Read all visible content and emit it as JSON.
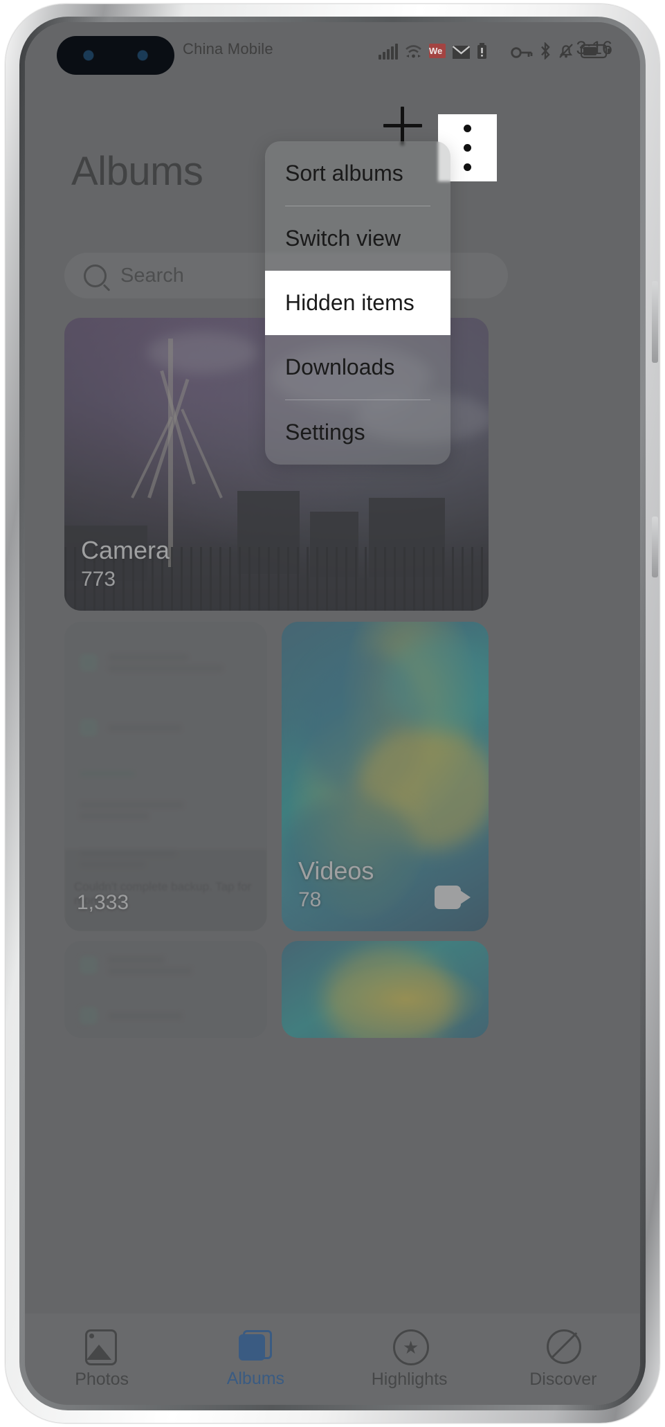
{
  "status_bar": {
    "carrier": "China Mobile",
    "clock": "3:16",
    "icons": [
      "signal-bars-icon",
      "wifi-icon",
      "wechat-icon",
      "mail-icon",
      "sim-alert-icon",
      "vpn-key-icon",
      "bluetooth-icon",
      "mute-bell-icon",
      "battery-icon"
    ],
    "wechat_badge": "We"
  },
  "appbar": {
    "add_label": "+",
    "more_label": "⋮"
  },
  "page": {
    "title": "Albums"
  },
  "search": {
    "placeholder": "Search",
    "icon": "search-icon"
  },
  "menu": {
    "items": [
      {
        "label": "Sort albums",
        "highlighted": false,
        "separator_after": true
      },
      {
        "label": "Switch view",
        "highlighted": false,
        "separator_after": false
      },
      {
        "label": "Hidden items",
        "highlighted": true,
        "separator_after": false
      },
      {
        "label": "Downloads",
        "highlighted": false,
        "separator_after": true
      },
      {
        "label": "Settings",
        "highlighted": false,
        "separator_after": false
      }
    ]
  },
  "albums": [
    {
      "title": "Camera",
      "count": "773"
    },
    {
      "title": "Videos",
      "count": "78"
    },
    {
      "title": "",
      "count": "1,333"
    }
  ],
  "blurred_card": {
    "banner_text": "Couldn't complete backup. Tap for more info.",
    "row_labels": [
      "Theme",
      "System default",
      "Wallpaper"
    ]
  },
  "bottom_nav": {
    "items": [
      {
        "label": "Photos",
        "icon": "photo-icon",
        "active": false
      },
      {
        "label": "Albums",
        "icon": "albums-icon",
        "active": true
      },
      {
        "label": "Highlights",
        "icon": "star-circle-icon",
        "active": false
      },
      {
        "label": "Discover",
        "icon": "discover-icon",
        "active": false
      }
    ]
  },
  "colors": {
    "accent": "#1558a8",
    "menu_highlight": "#ffffff",
    "scrim": "#5c5d5f",
    "wechat_red": "#a34442"
  }
}
